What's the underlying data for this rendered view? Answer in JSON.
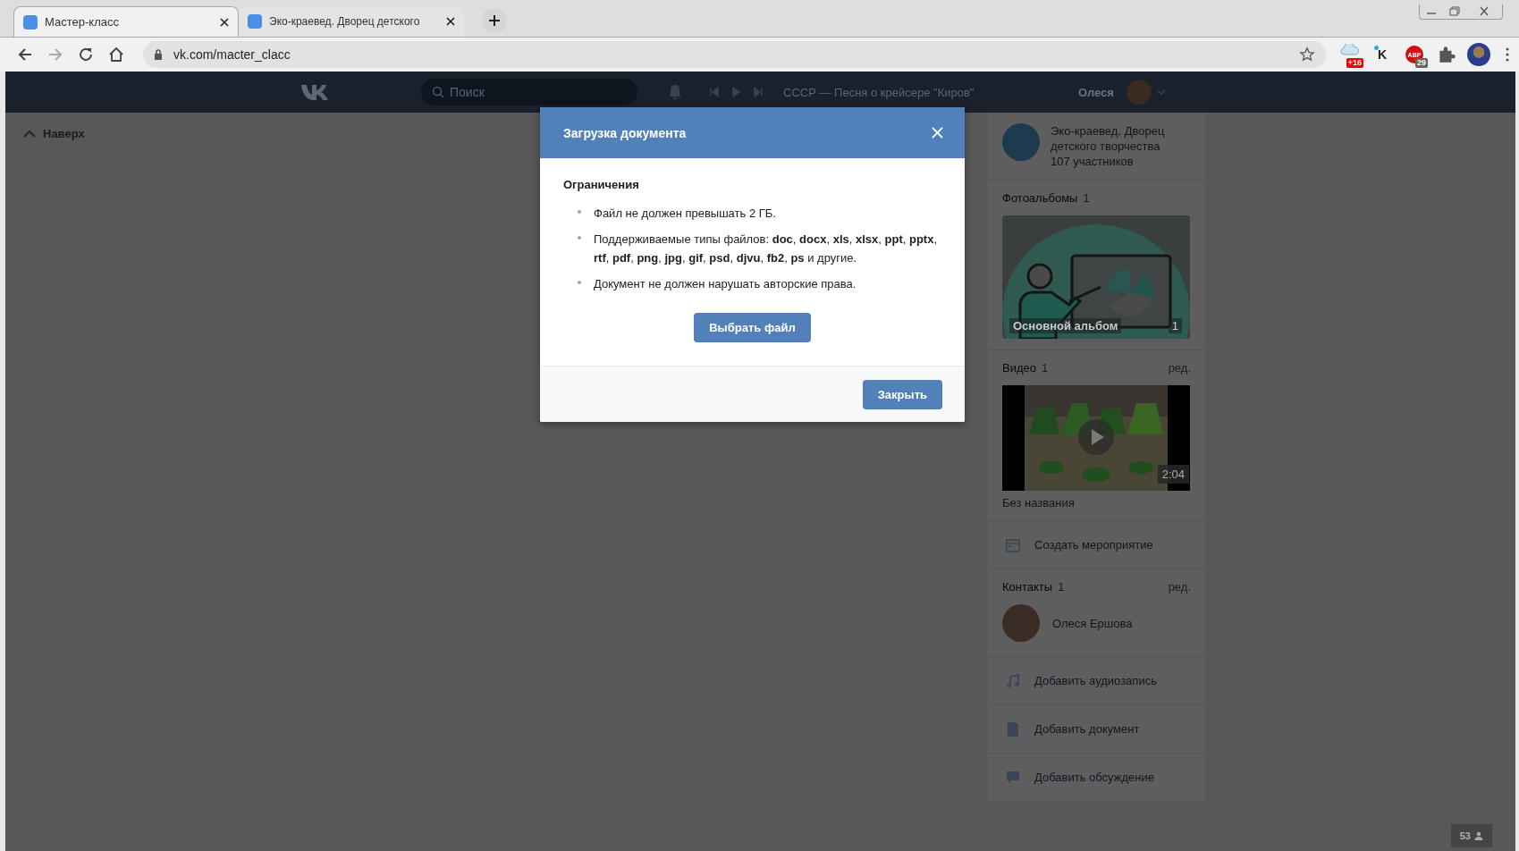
{
  "browser": {
    "tabs": [
      {
        "title": "Мастер-класс",
        "selected": true
      },
      {
        "title": "Эко-краевед. Дворец детского",
        "selected": false
      }
    ],
    "url": "vk.com/macter_clacc",
    "extensions": [
      {
        "kind": "cloud",
        "badge": "+16"
      },
      {
        "kind": "letter",
        "label": "K"
      },
      {
        "kind": "adblock",
        "label": "ABP",
        "badge": "29"
      },
      {
        "kind": "puzzle"
      },
      {
        "kind": "avatar"
      }
    ]
  },
  "vk_header": {
    "search_placeholder": "Поиск",
    "track": "СССР — Песня о крейсере \"Киров\"",
    "user_name": "Олеся"
  },
  "back_to_top": "Наверх",
  "modal": {
    "title": "Загрузка документа",
    "section_title": "Ограничения",
    "rules": [
      "Файл не должен превышать 2 ГБ.",
      "Поддерживаемые типы файлов: **doc**, **docx**, **xls**, **xlsx**, **ppt**, **pptx**, **rtf**, **pdf**, **png**, **jpg**, **gif**, **psd**, **djvu**, **fb2**, **ps** и другие.",
      "Документ не должен нарушать авторские права."
    ],
    "choose_button": "Выбрать файл",
    "close_button": "Закрыть"
  },
  "sidebar": {
    "group": {
      "name": "Эко-краевед. Дворец детского творчества",
      "members": "107 участников"
    },
    "photo_albums": {
      "title": "Фотоальбомы",
      "count": "1",
      "album": {
        "name": "Основной альбом",
        "count": "1"
      }
    },
    "video": {
      "title": "Видео",
      "count": "1",
      "edit": "ред.",
      "duration": "2:04",
      "caption": "Без названия"
    },
    "create_event": {
      "kind": "event",
      "label": "Создать мероприятие"
    },
    "contacts": {
      "title": "Контакты",
      "count": "1",
      "edit": "ред.",
      "people": [
        {
          "name": "Олеся Ершова"
        }
      ]
    },
    "actions": [
      {
        "kind": "audio",
        "label": "Добавить аудиозапись"
      },
      {
        "kind": "document",
        "label": "Добавить документ"
      },
      {
        "kind": "discussion",
        "label": "Добавить обсуждение"
      }
    ]
  },
  "online_badge": "53"
}
